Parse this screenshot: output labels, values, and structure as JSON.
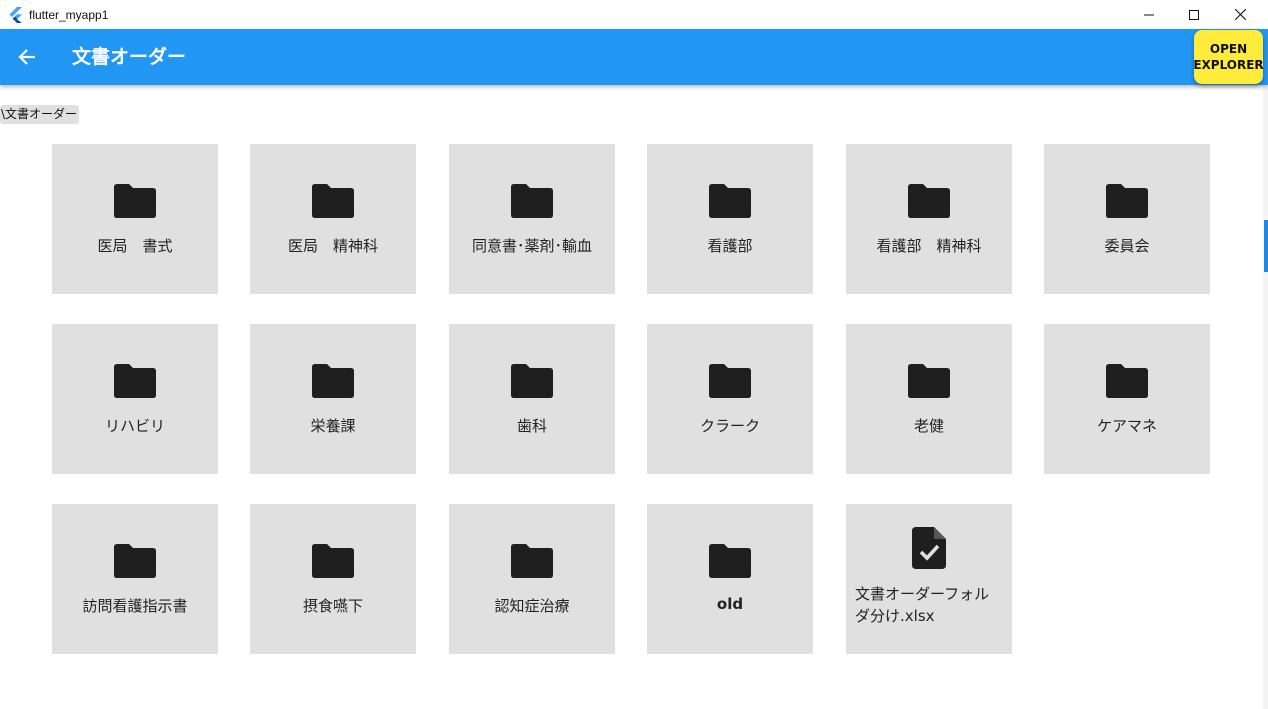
{
  "window": {
    "title": "flutter_myapp1"
  },
  "appbar": {
    "title": "文書オーダー",
    "open_button": "OPEN\nEXPLORER",
    "color": "#2196f3",
    "button_color": "#ffeb3b"
  },
  "path": "\\文書オーダー",
  "tiles": [
    {
      "label": "医局　書式",
      "icon": "folder-icon"
    },
    {
      "label": "医局　精神科",
      "icon": "folder-icon"
    },
    {
      "label": "同意書･薬剤･輸血",
      "icon": "folder-icon"
    },
    {
      "label": "看護部",
      "icon": "folder-icon"
    },
    {
      "label": "看護部　精神科",
      "icon": "folder-icon"
    },
    {
      "label": "委員会",
      "icon": "folder-icon"
    },
    {
      "label": "リハビリ",
      "icon": "folder-icon"
    },
    {
      "label": "栄養課",
      "icon": "folder-icon"
    },
    {
      "label": "歯科",
      "icon": "folder-icon"
    },
    {
      "label": "クラーク",
      "icon": "folder-icon"
    },
    {
      "label": "老健",
      "icon": "folder-icon"
    },
    {
      "label": "ケアマネ",
      "icon": "folder-icon"
    },
    {
      "label": "訪問看護指示書",
      "icon": "folder-icon"
    },
    {
      "label": "摂食嚥下",
      "icon": "folder-icon"
    },
    {
      "label": "認知症治療",
      "icon": "folder-icon"
    },
    {
      "label": "old",
      "icon": "folder-icon"
    },
    {
      "label": "文書オーダーフォルダ分け.xlsx",
      "icon": "file-check-icon"
    }
  ],
  "tile_color": "#e0e0e0"
}
